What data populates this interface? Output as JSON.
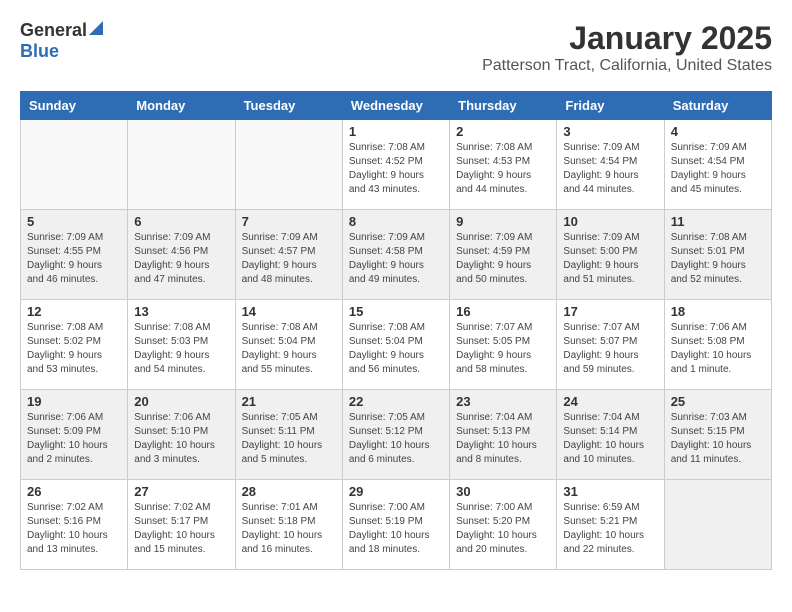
{
  "logo": {
    "general": "General",
    "blue": "Blue"
  },
  "title": "January 2025",
  "location": "Patterson Tract, California, United States",
  "days_of_week": [
    "Sunday",
    "Monday",
    "Tuesday",
    "Wednesday",
    "Thursday",
    "Friday",
    "Saturday"
  ],
  "weeks": [
    [
      {
        "day": "",
        "info": ""
      },
      {
        "day": "",
        "info": ""
      },
      {
        "day": "",
        "info": ""
      },
      {
        "day": "1",
        "info": "Sunrise: 7:08 AM\nSunset: 4:52 PM\nDaylight: 9 hours and 43 minutes."
      },
      {
        "day": "2",
        "info": "Sunrise: 7:08 AM\nSunset: 4:53 PM\nDaylight: 9 hours and 44 minutes."
      },
      {
        "day": "3",
        "info": "Sunrise: 7:09 AM\nSunset: 4:54 PM\nDaylight: 9 hours and 44 minutes."
      },
      {
        "day": "4",
        "info": "Sunrise: 7:09 AM\nSunset: 4:54 PM\nDaylight: 9 hours and 45 minutes."
      }
    ],
    [
      {
        "day": "5",
        "info": "Sunrise: 7:09 AM\nSunset: 4:55 PM\nDaylight: 9 hours and 46 minutes."
      },
      {
        "day": "6",
        "info": "Sunrise: 7:09 AM\nSunset: 4:56 PM\nDaylight: 9 hours and 47 minutes."
      },
      {
        "day": "7",
        "info": "Sunrise: 7:09 AM\nSunset: 4:57 PM\nDaylight: 9 hours and 48 minutes."
      },
      {
        "day": "8",
        "info": "Sunrise: 7:09 AM\nSunset: 4:58 PM\nDaylight: 9 hours and 49 minutes."
      },
      {
        "day": "9",
        "info": "Sunrise: 7:09 AM\nSunset: 4:59 PM\nDaylight: 9 hours and 50 minutes."
      },
      {
        "day": "10",
        "info": "Sunrise: 7:09 AM\nSunset: 5:00 PM\nDaylight: 9 hours and 51 minutes."
      },
      {
        "day": "11",
        "info": "Sunrise: 7:08 AM\nSunset: 5:01 PM\nDaylight: 9 hours and 52 minutes."
      }
    ],
    [
      {
        "day": "12",
        "info": "Sunrise: 7:08 AM\nSunset: 5:02 PM\nDaylight: 9 hours and 53 minutes."
      },
      {
        "day": "13",
        "info": "Sunrise: 7:08 AM\nSunset: 5:03 PM\nDaylight: 9 hours and 54 minutes."
      },
      {
        "day": "14",
        "info": "Sunrise: 7:08 AM\nSunset: 5:04 PM\nDaylight: 9 hours and 55 minutes."
      },
      {
        "day": "15",
        "info": "Sunrise: 7:08 AM\nSunset: 5:04 PM\nDaylight: 9 hours and 56 minutes."
      },
      {
        "day": "16",
        "info": "Sunrise: 7:07 AM\nSunset: 5:05 PM\nDaylight: 9 hours and 58 minutes."
      },
      {
        "day": "17",
        "info": "Sunrise: 7:07 AM\nSunset: 5:07 PM\nDaylight: 9 hours and 59 minutes."
      },
      {
        "day": "18",
        "info": "Sunrise: 7:06 AM\nSunset: 5:08 PM\nDaylight: 10 hours and 1 minute."
      }
    ],
    [
      {
        "day": "19",
        "info": "Sunrise: 7:06 AM\nSunset: 5:09 PM\nDaylight: 10 hours and 2 minutes."
      },
      {
        "day": "20",
        "info": "Sunrise: 7:06 AM\nSunset: 5:10 PM\nDaylight: 10 hours and 3 minutes."
      },
      {
        "day": "21",
        "info": "Sunrise: 7:05 AM\nSunset: 5:11 PM\nDaylight: 10 hours and 5 minutes."
      },
      {
        "day": "22",
        "info": "Sunrise: 7:05 AM\nSunset: 5:12 PM\nDaylight: 10 hours and 6 minutes."
      },
      {
        "day": "23",
        "info": "Sunrise: 7:04 AM\nSunset: 5:13 PM\nDaylight: 10 hours and 8 minutes."
      },
      {
        "day": "24",
        "info": "Sunrise: 7:04 AM\nSunset: 5:14 PM\nDaylight: 10 hours and 10 minutes."
      },
      {
        "day": "25",
        "info": "Sunrise: 7:03 AM\nSunset: 5:15 PM\nDaylight: 10 hours and 11 minutes."
      }
    ],
    [
      {
        "day": "26",
        "info": "Sunrise: 7:02 AM\nSunset: 5:16 PM\nDaylight: 10 hours and 13 minutes."
      },
      {
        "day": "27",
        "info": "Sunrise: 7:02 AM\nSunset: 5:17 PM\nDaylight: 10 hours and 15 minutes."
      },
      {
        "day": "28",
        "info": "Sunrise: 7:01 AM\nSunset: 5:18 PM\nDaylight: 10 hours and 16 minutes."
      },
      {
        "day": "29",
        "info": "Sunrise: 7:00 AM\nSunset: 5:19 PM\nDaylight: 10 hours and 18 minutes."
      },
      {
        "day": "30",
        "info": "Sunrise: 7:00 AM\nSunset: 5:20 PM\nDaylight: 10 hours and 20 minutes."
      },
      {
        "day": "31",
        "info": "Sunrise: 6:59 AM\nSunset: 5:21 PM\nDaylight: 10 hours and 22 minutes."
      },
      {
        "day": "",
        "info": ""
      }
    ]
  ]
}
